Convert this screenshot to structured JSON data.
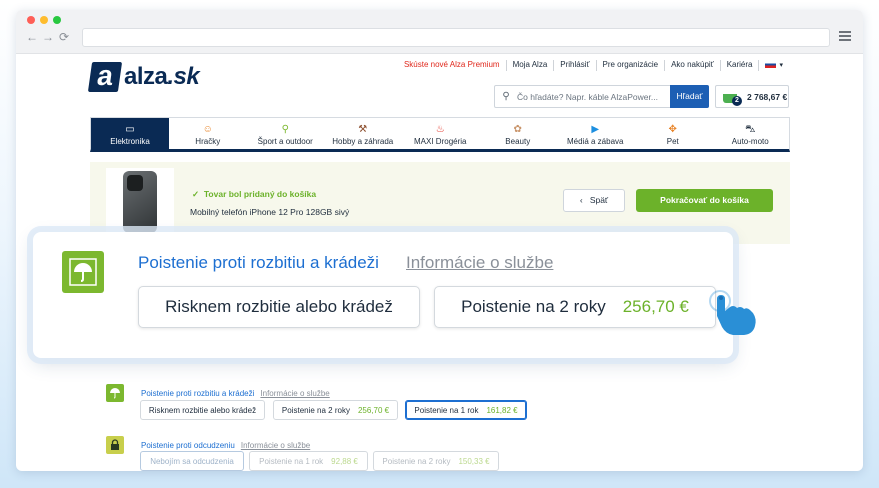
{
  "browser": {
    "back_glyph": "←",
    "forward_glyph": "→",
    "reload_glyph": "⟳"
  },
  "site": {
    "logo_mark": "a",
    "logo_name": "alza",
    "logo_tld": ".sk"
  },
  "toplinks": [
    "Skúste nové Alza Premium",
    "Moja Alza",
    "Prihlásiť",
    "Pre organizácie",
    "Ako nakúpiť",
    "Kariéra"
  ],
  "search": {
    "placeholder": "Čo hľadáte? Napr. káble AlzaPower...",
    "button": "Hľadať"
  },
  "cart": {
    "count": "2",
    "total": "2 768,67 €"
  },
  "categories": [
    {
      "label": "Elektronika",
      "icon": "laptop-icon",
      "glyph": "▭"
    },
    {
      "label": "Hračky",
      "icon": "toy-icon",
      "glyph": "☺"
    },
    {
      "label": "Šport a outdoor",
      "icon": "bicycle-icon",
      "glyph": "⚲"
    },
    {
      "label": "Hobby a záhrada",
      "icon": "drill-icon",
      "glyph": "⚒"
    },
    {
      "label": "MAXI Drogéria",
      "icon": "spray-icon",
      "glyph": "♨"
    },
    {
      "label": "Beauty",
      "icon": "cosmetics-icon",
      "glyph": "✿"
    },
    {
      "label": "Médiá a zábava",
      "icon": "play-icon",
      "glyph": "▶"
    },
    {
      "label": "Pet",
      "icon": "paw-icon",
      "glyph": "✥"
    },
    {
      "label": "Auto-moto",
      "icon": "car-icon",
      "glyph": "⛍"
    }
  ],
  "added": {
    "check": "✓",
    "title": "Tovar bol pridaný do košíka",
    "product": "Mobilný telefón iPhone 12 Pro 128GB sivý",
    "back_label": "Späť",
    "back_glyph": "‹",
    "continue_label": "Pokračovať do košíka"
  },
  "zoom_panel": {
    "title": "Poistenie proti rozbitiu a krádeži",
    "info": "Informácie o službe",
    "option_decline": "Risknem rozbitie alebo krádež",
    "option_2y_label": "Poistenie na 2 roky",
    "option_2y_price": "256,70 €"
  },
  "insurance_breakage": {
    "title": "Poistenie proti rozbitiu a krádeži",
    "info": "Informácie o službe",
    "options": [
      {
        "label": "Risknem rozbitie alebo krádež",
        "price": ""
      },
      {
        "label": "Poistenie na 2 roky",
        "price": "256,70 €"
      },
      {
        "label": "Poistenie na 1 rok",
        "price": "161,82 €"
      }
    ]
  },
  "insurance_theft": {
    "title": "Poistenie proti odcudzeniu",
    "info": "Informácie o službe",
    "options": [
      {
        "label": "Nebojím sa odcudzenia",
        "price": ""
      },
      {
        "label": "Poistenie na 1 rok",
        "price": "92,88 €"
      },
      {
        "label": "Poistenie na 2 roky",
        "price": "150,33 €"
      }
    ]
  },
  "colors": {
    "brand_navy": "#0a2a54",
    "accent_green": "#6cb22a",
    "link_blue": "#1d6fd1",
    "alert_red": "#e0281c"
  }
}
